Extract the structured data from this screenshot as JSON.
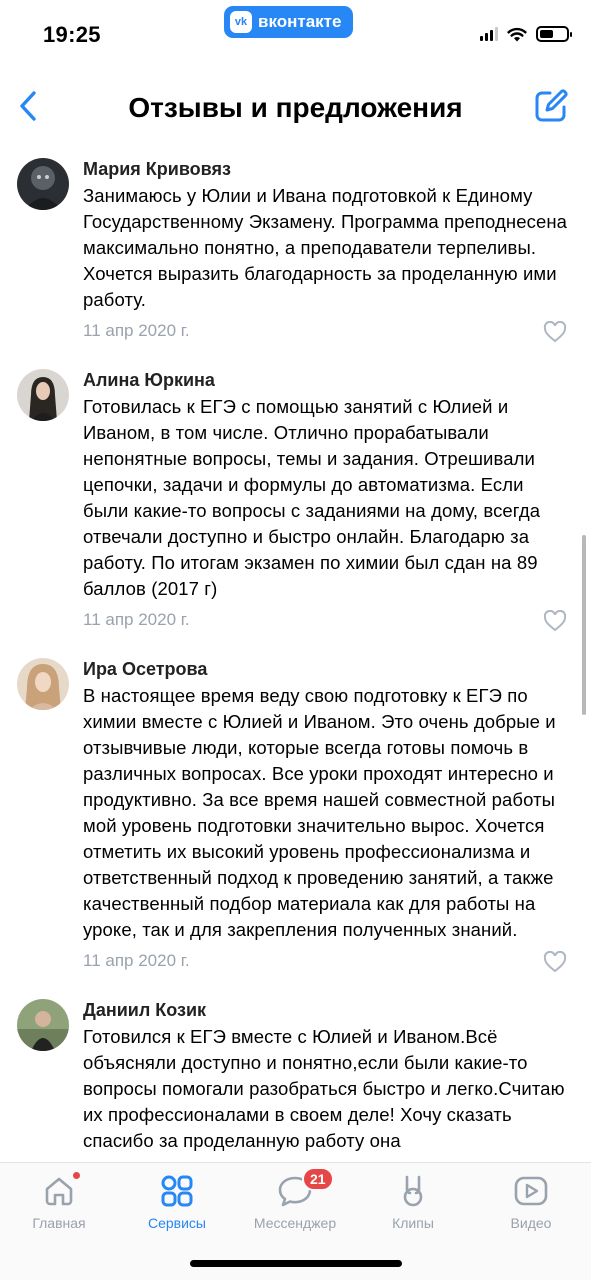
{
  "status_bar": {
    "time": "19:25",
    "app_pill": "вконтакте",
    "vk_logo": "vk"
  },
  "header": {
    "title": "Отзывы и предложения",
    "back_icon": "chevron-left-icon",
    "compose_icon": "compose-icon"
  },
  "reviews": [
    {
      "author": "Мария Кривовяз",
      "text": "Занимаюсь у Юлии и Ивана подготовкой к Единому Государственному Экзамену. Программа преподнесена максимально понятно, а преподаватели терпеливы. Хочется выразить благодарность за проделанную ими работу.",
      "date": "11 апр 2020 г."
    },
    {
      "author": "Алина Юркина",
      "text": "Готовилась к ЕГЭ с помощью занятий с Юлией и Иваном, в том числе. Отлично прорабатывали непонятные вопросы, темы и задания. Отрешивали цепочки, задачи и формулы до автоматизма. Если были какие-то вопросы с заданиями на дому, всегда отвечали доступно и быстро онлайн. Благодарю за работу. По итогам экзамен по химии был сдан на 89 баллов (2017 г)",
      "date": "11 апр 2020 г."
    },
    {
      "author": "Ира Осетрова",
      "text": "В настоящее время веду свою подготовку к ЕГЭ по химии вместе с Юлией и Иваном. Это очень добрые и отзывчивые люди, которые всегда готовы помочь в различных вопросах. Все уроки проходят интересно и продуктивно. За все время нашей совместной работы мой уровень подготовки значительно вырос. Хочется отметить их высокий уровень профессионализма и ответственный подход к проведению занятий, а также качественный подбор материала как для работы на уроке, так и для закрепления полученных знаний.",
      "date": "11 апр 2020 г."
    },
    {
      "author": "Даниил Козик",
      "text": "Готовился к ЕГЭ вместе с Юлией и Иваном.Всё объясняли доступно и понятно,если были какие-то вопросы помогали разобраться быстро и легко.Считаю их профессионалами в своем деле! Хочу сказать спасибо за проделанную работу она",
      "date": ""
    }
  ],
  "tabbar": {
    "tabs": [
      {
        "label": "Главная",
        "icon": "home-icon",
        "active": false
      },
      {
        "label": "Сервисы",
        "icon": "services-icon",
        "active": true
      },
      {
        "label": "Мессенджер",
        "icon": "chat-icon",
        "active": false,
        "badge": "21"
      },
      {
        "label": "Клипы",
        "icon": "clips-icon",
        "active": false
      },
      {
        "label": "Видео",
        "icon": "video-icon",
        "active": false
      }
    ]
  },
  "colors": {
    "accent": "#2787f5",
    "secondary_text": "#99a2ad",
    "badge": "#e64646"
  }
}
